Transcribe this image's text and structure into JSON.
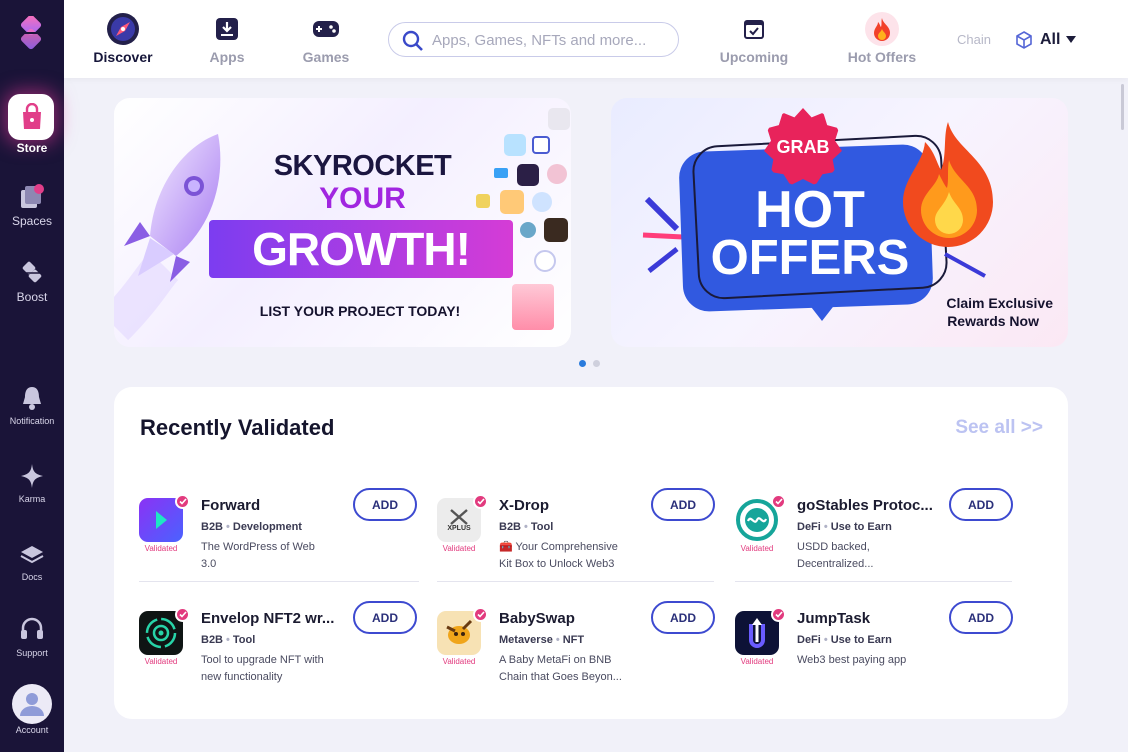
{
  "sidebar": {
    "items": [
      {
        "label": "Store",
        "icon": "shopping-bag-icon"
      },
      {
        "label": "Spaces",
        "icon": "spaces-icon"
      },
      {
        "label": "Boost",
        "icon": "boost-icon"
      },
      {
        "label": "Notification",
        "icon": "bell-icon"
      },
      {
        "label": "Karma",
        "icon": "sparkle-icon"
      },
      {
        "label": "Docs",
        "icon": "docs-icon"
      },
      {
        "label": "Support",
        "icon": "headset-icon"
      },
      {
        "label": "Account",
        "icon": "user-icon"
      }
    ]
  },
  "header": {
    "tabs": [
      {
        "label": "Discover",
        "icon": "compass-icon",
        "active": true
      },
      {
        "label": "Apps",
        "icon": "download-box-icon",
        "active": false
      },
      {
        "label": "Games",
        "icon": "gamepad-icon",
        "active": false
      },
      {
        "label": "Upcoming",
        "icon": "calendar-icon",
        "active": false
      },
      {
        "label": "Hot Offers",
        "icon": "fire-icon",
        "active": false
      }
    ],
    "search_placeholder": "Apps, Games, NFTs and more...",
    "chain_label": "Chain",
    "chain_value": "All"
  },
  "banners": {
    "left": {
      "line1": "SKYROCKET",
      "line2": "YOUR",
      "line3": "GROWTH!",
      "cta": "LIST YOUR PROJECT TODAY!"
    },
    "right": {
      "badge": "GRAB",
      "line1": "HOT",
      "line2": "OFFERS",
      "caption1": "Claim Exclusive",
      "caption2": "Rewards Now"
    }
  },
  "recent": {
    "title": "Recently Validated",
    "see_all": "See all >>",
    "validated_label": "Validated",
    "add_label": "ADD",
    "apps": [
      {
        "name": "Forward",
        "category": "B2B",
        "subcategory": "Development",
        "desc": "The WordPress of Web 3.0",
        "icon": "forward-arrow-icon",
        "color": "#7b3df0"
      },
      {
        "name": "X-Drop",
        "category": "B2B",
        "subcategory": "Tool",
        "desc": "🧰 Your Comprehensive Kit Box to Unlock Web3",
        "icon": "xplus-logo-icon",
        "logo_text": "XPLUS",
        "color": "#efefef"
      },
      {
        "name": "goStables Protoc...",
        "category": "DeFi",
        "subcategory": "Use to Earn",
        "desc": "USDD backed, Decentralized...",
        "icon": "gostables-logo-icon",
        "color": "#16a59a"
      },
      {
        "name": "Envelop NFT2 wr...",
        "category": "B2B",
        "subcategory": "Tool",
        "desc": "Tool to upgrade NFT with new functionality",
        "icon": "envelop-logo-icon",
        "color": "#101615"
      },
      {
        "name": "BabySwap",
        "category": "Metaverse",
        "subcategory": "NFT",
        "desc": "A Baby MetaFi on BNB Chain that Goes Beyon...",
        "icon": "babyswap-logo-icon",
        "color": "#f7e3b6"
      },
      {
        "name": "JumpTask",
        "category": "DeFi",
        "subcategory": "Use to Earn",
        "desc": "Web3 best paying app",
        "icon": "jumptask-logo-icon",
        "color": "#0d1236"
      }
    ]
  }
}
